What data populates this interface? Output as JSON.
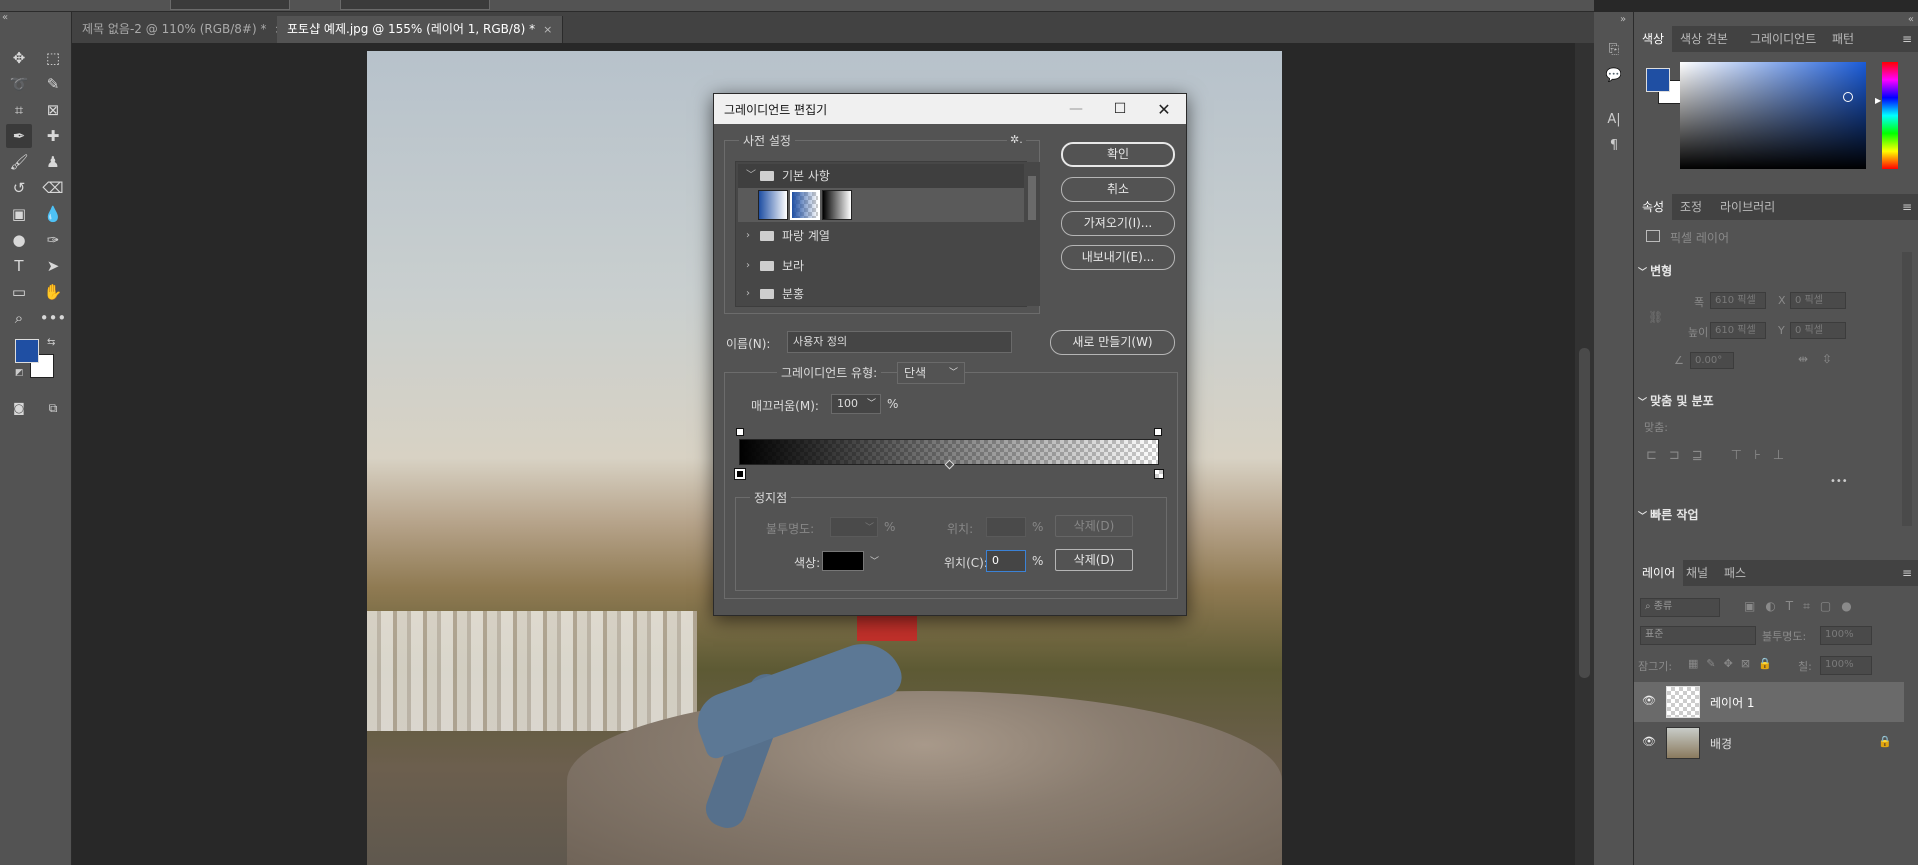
{
  "doc_tabs": [
    {
      "label": "제목 없음-2 @ 110% (RGB/8#) *",
      "close": "×"
    },
    {
      "label": "포토샵 예제.jpg @ 155% (레이어 1, RGB/8) *",
      "close": "×"
    }
  ],
  "toolbar": {
    "foreground_color": "#1f4fa3",
    "background_color": "#ffffff"
  },
  "panels": {
    "color_tabs": [
      "색상",
      "색상 견본",
      "그레이디언트",
      "패턴"
    ],
    "props_tabs": [
      "속성",
      "조정",
      "라이브러리"
    ],
    "pixel_layer": "픽셀 레이어",
    "transform": {
      "title": "변형",
      "w_label": "폭",
      "w_value": "610 픽셀",
      "x_label": "X",
      "x_value": "0 픽셀",
      "h_label": "높이",
      "h_value": "610 픽셀",
      "y_label": "Y",
      "y_value": "0 픽셀",
      "angle_value": "0.00°"
    },
    "align": {
      "title": "맞춤 및 분포",
      "subtitle": "맞춤:",
      "more": "•••"
    },
    "quick": {
      "title": "빠른 작업"
    },
    "layer_tabs": [
      "레이어",
      "채널",
      "패스"
    ],
    "layer_filter": "종류",
    "blend_mode": "표준",
    "opacity_label": "불투명도:",
    "opacity_value": "100%",
    "lock_label": "잠그기:",
    "fill_label": "칠:",
    "fill_value": "100%",
    "layers": [
      {
        "name": "레이어 1",
        "selected": true
      },
      {
        "name": "배경",
        "selected": false
      }
    ]
  },
  "dialog": {
    "title": "그레이디언트 편집기",
    "presets_legend": "사전 설정",
    "folders": [
      {
        "name": "기본 사항",
        "expanded": true
      },
      {
        "name": "파랑 계열",
        "expanded": false
      },
      {
        "name": "보라",
        "expanded": false
      },
      {
        "name": "분홍",
        "expanded": false
      }
    ],
    "buttons": {
      "ok": "확인",
      "cancel": "취소",
      "import": "가져오기(I)...",
      "export": "내보내기(E)...",
      "new": "새로 만들기(W)"
    },
    "name_label": "이름(N):",
    "name_value": "사용자 정의",
    "type_label": "그레이디언트 유형:",
    "type_value": "단색",
    "smooth_label": "매끄러움(M):",
    "smooth_value": "100",
    "percent": "%",
    "stops_legend": "정지점",
    "opacity_label": "불투명도:",
    "location_label": "위치:",
    "delete_label": "삭제(D)",
    "color_label": "색상:",
    "color_value": "#000000",
    "color_location_label": "위치(C):",
    "color_location_value": "0"
  }
}
